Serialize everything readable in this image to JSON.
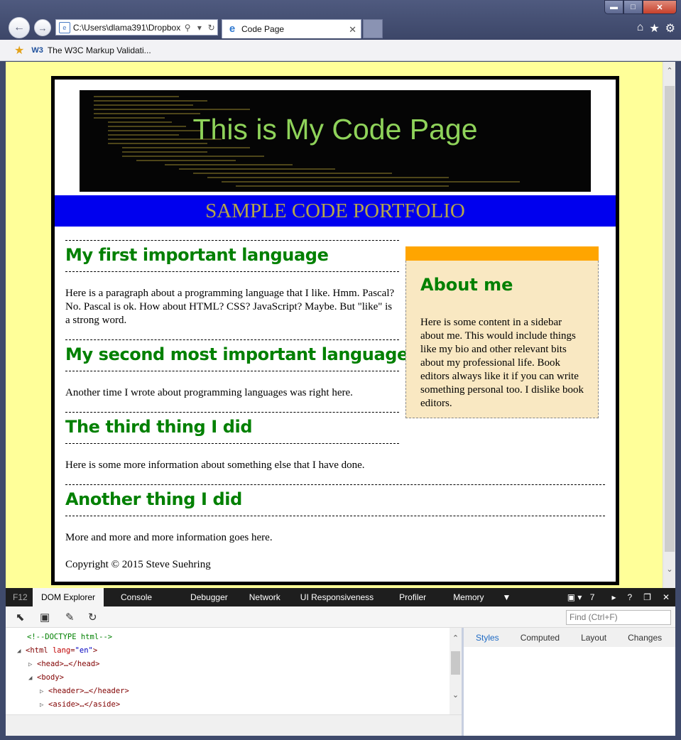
{
  "browser": {
    "window_controls": {
      "minimize": "▬",
      "maximize": "□",
      "close": "✕"
    },
    "address": "C:\\Users\\dlama391\\Dropbox",
    "tab_title": "Code Page",
    "favorite_label": "The W3C Markup Validati...",
    "favorite_prefix": "W3",
    "tool_icons": [
      "home-icon",
      "star-icon",
      "gear-icon"
    ]
  },
  "page": {
    "banner_title": "This is My Code Page",
    "subtitle": "SAMPLE CODE PORTFOLIO",
    "sections": [
      {
        "heading": "My first important language",
        "text": "Here is a paragraph about a programming language that I like. Hmm. Pascal? No. Pascal is ok. How about HTML? CSS? JavaScript? Maybe. But \"like\" is a strong word."
      },
      {
        "heading": "My second most important language",
        "text": "Another time I wrote about programming languages was right here."
      },
      {
        "heading": "The third thing I did",
        "text": "Here is some more information about something else that I have done."
      },
      {
        "heading": "Another thing I did",
        "text": "More and more and more information goes here."
      }
    ],
    "aside": {
      "heading": "About me",
      "text": "Here is some content in a sidebar about me. This would include things like my bio and other relevant bits about my professional life. Book editors always like it if you can write something personal too. I dislike book editors."
    },
    "footer": "Copyright © 2015 Steve Suehring",
    "colors": {
      "background": "#ffff99",
      "heading": "#008000",
      "subtitle_bar": "#0000ee",
      "aside_bar": "#ffa500",
      "aside_bg": "#f9e8c2"
    }
  },
  "devtools": {
    "f12": "F12",
    "tabs": [
      "DOM Explorer",
      "Console",
      "Debugger",
      "Network",
      "UI Responsiveness",
      "Profiler",
      "Memory"
    ],
    "emulation_version": "7",
    "find_placeholder": "Find (Ctrl+F)",
    "dom_lines": {
      "doctype": "<!--DOCTYPE html-->",
      "html_open": "<html ",
      "html_attr": "lang",
      "html_val": "\"en\"",
      "head": "<head>…</head>",
      "body": "<body>",
      "header": "<header>…</header>",
      "aside": "<aside>…</aside>"
    },
    "style_tabs": [
      "Styles",
      "Computed",
      "Layout",
      "Changes"
    ]
  }
}
